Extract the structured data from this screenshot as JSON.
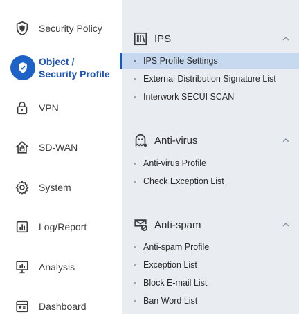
{
  "sidebar": {
    "items": [
      {
        "label": "Security Policy",
        "icon": "shield-icon"
      },
      {
        "label": "Object /\nSecurity Profile",
        "icon": "shield-check-icon",
        "active": true
      },
      {
        "label": "VPN",
        "icon": "lock-icon"
      },
      {
        "label": "SD-WAN",
        "icon": "home-lock-icon"
      },
      {
        "label": "System",
        "icon": "gear-icon"
      },
      {
        "label": "Log/Report",
        "icon": "bar-report-icon"
      },
      {
        "label": "Analysis",
        "icon": "monitor-chart-icon"
      },
      {
        "label": "Dashboard",
        "icon": "dashboard-icon"
      }
    ]
  },
  "panel": {
    "sections": [
      {
        "title": "IPS",
        "icon": "ips-icon",
        "items": [
          {
            "label": "IPS Profile Settings",
            "selected": true
          },
          {
            "label": "External Distribution Signature List"
          },
          {
            "label": "Interwork SECUI SCAN"
          }
        ]
      },
      {
        "title": "Anti-virus",
        "icon": "virus-ghost-icon",
        "items": [
          {
            "label": "Anti-virus Profile"
          },
          {
            "label": "Check Exception List"
          }
        ]
      },
      {
        "title": "Anti-spam",
        "icon": "mail-block-icon",
        "items": [
          {
            "label": "Anti-spam Profile"
          },
          {
            "label": "Exception List"
          },
          {
            "label": "Block E-mail List"
          },
          {
            "label": "Ban Word List"
          }
        ]
      }
    ]
  },
  "colors": {
    "accent": "#1f55b8",
    "panel_bg": "#e9ecf1",
    "selected_bg": "#c6d9ee"
  }
}
